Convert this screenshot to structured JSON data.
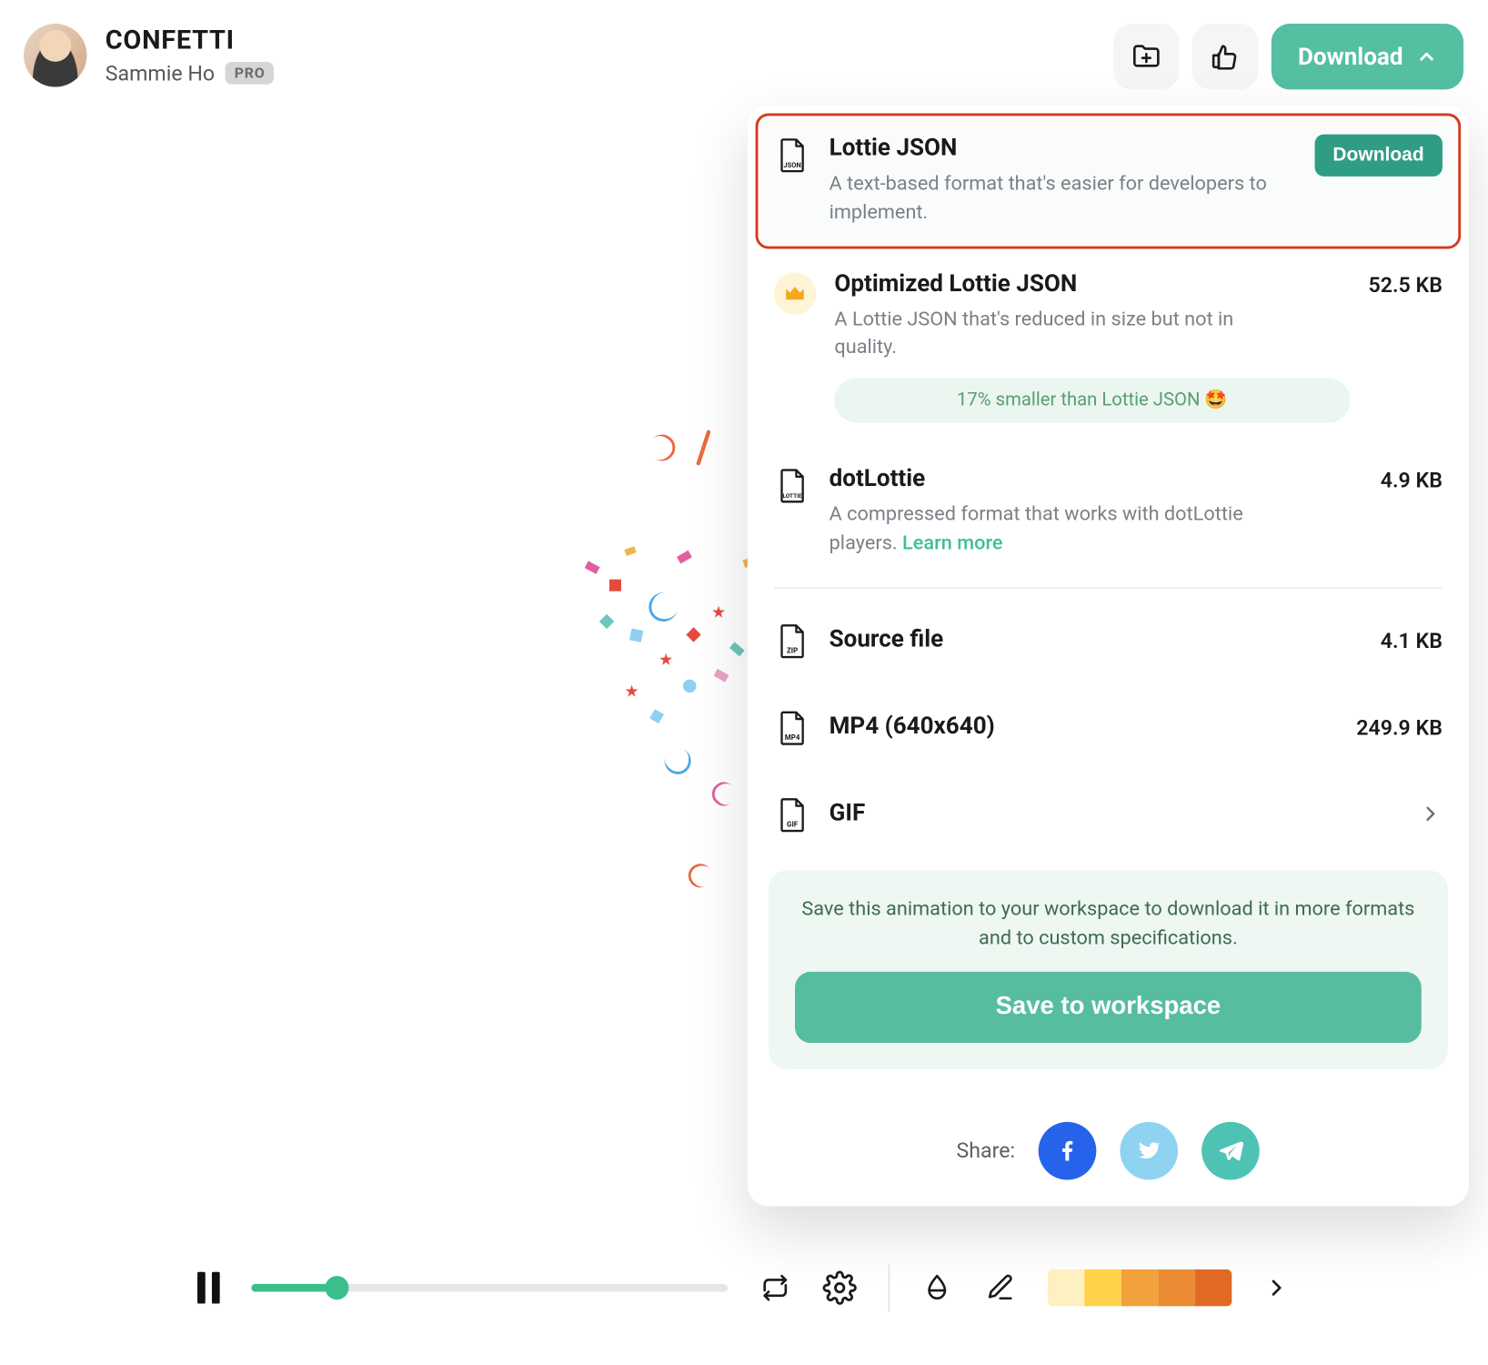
{
  "header": {
    "title": "CONFETTI",
    "author": "Sammie Ho",
    "badge": "PRO",
    "download_label": "Download"
  },
  "dropdown": {
    "options": [
      {
        "title": "Lottie JSON",
        "desc": "A text-based format that's easier for developers to implement.",
        "action": "Download"
      },
      {
        "title": "Optimized Lottie JSON",
        "desc": "A Lottie JSON that's reduced in size but not in quality.",
        "size": "52.5 KB",
        "pill": "17% smaller than Lottie JSON 🤩"
      },
      {
        "title": "dotLottie",
        "desc_pre": "A compressed format that works with dotLottie players. ",
        "desc_link": "Learn more",
        "size": "4.9 KB"
      },
      {
        "title": "Source file",
        "size": "4.1 KB"
      },
      {
        "title": "MP4 (640x640)",
        "size": "249.9 KB"
      },
      {
        "title": "GIF"
      }
    ],
    "workspace": {
      "text": "Save this animation to your workspace to download it in more formats and to custom specifications.",
      "button": "Save to workspace"
    },
    "share_label": "Share:"
  },
  "palette_colors": [
    "#fff0c2",
    "#ffd24a",
    "#f2a23c",
    "#ea8b33",
    "#e06a23"
  ]
}
